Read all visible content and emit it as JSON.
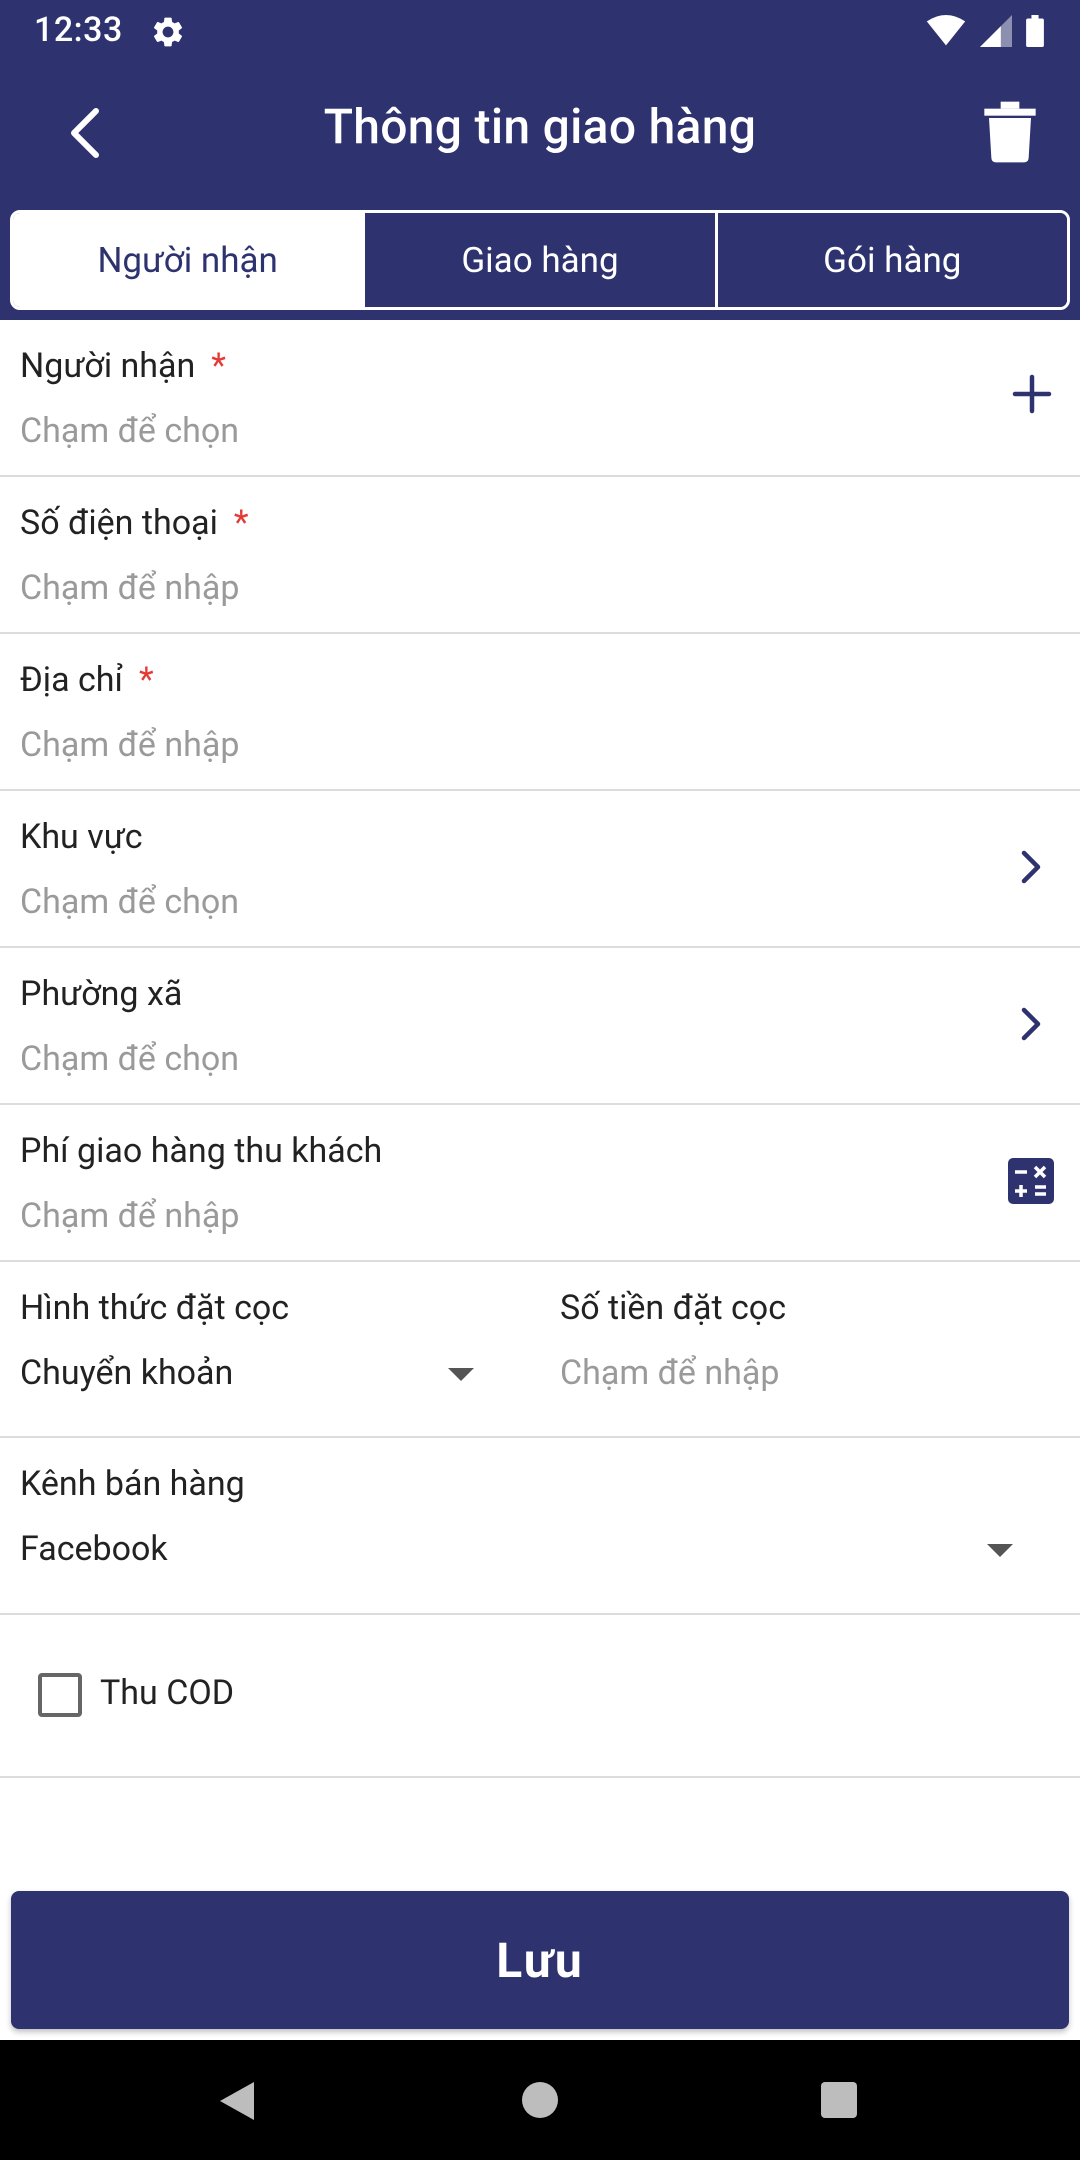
{
  "status_bar": {
    "time": "12:33"
  },
  "app_bar": {
    "title": "Thông tin giao hàng"
  },
  "tabs": [
    {
      "label": "Người nhận",
      "active": true
    },
    {
      "label": "Giao hàng",
      "active": false
    },
    {
      "label": "Gói hàng",
      "active": false
    }
  ],
  "form": {
    "recipient": {
      "label": "Người nhận",
      "required_mark": "*",
      "placeholder": "Chạm để chọn"
    },
    "phone": {
      "label": "Số điện thoại",
      "required_mark": "*",
      "placeholder": "Chạm để nhập"
    },
    "address": {
      "label": "Địa chỉ",
      "required_mark": "*",
      "placeholder": "Chạm để nhập"
    },
    "area": {
      "label": "Khu vực",
      "placeholder": "Chạm để chọn"
    },
    "ward": {
      "label": "Phường xã",
      "placeholder": "Chạm để chọn"
    },
    "shipping_fee": {
      "label": "Phí giao hàng thu khách",
      "placeholder": "Chạm để nhập"
    },
    "deposit_method": {
      "label": "Hình thức đặt cọc",
      "value": "Chuyển khoản"
    },
    "deposit_amount": {
      "label": "Số tiền đặt cọc",
      "placeholder": "Chạm để nhập"
    },
    "sales_channel": {
      "label": "Kênh bán hàng",
      "value": "Facebook"
    },
    "cod": {
      "label": "Thu COD",
      "checked": false
    }
  },
  "save_button": {
    "label": "Lưu"
  },
  "colors": {
    "primary": "#2e3370",
    "required": "#e53935",
    "placeholder": "#9a9a9a"
  }
}
